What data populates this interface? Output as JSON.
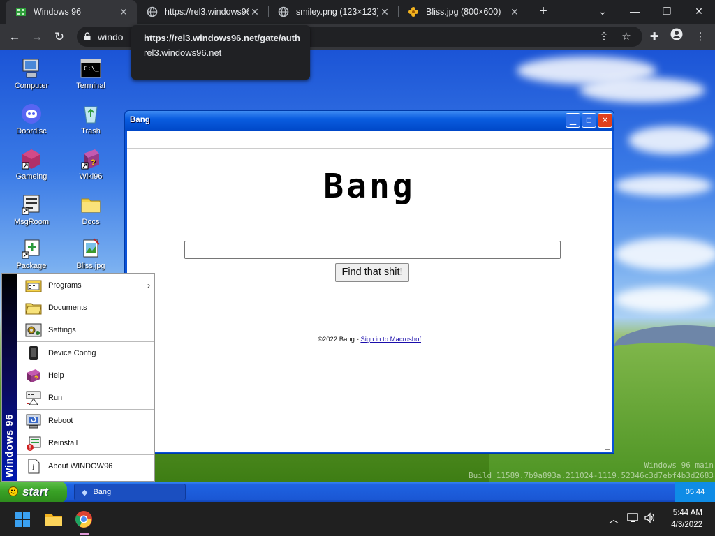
{
  "browser": {
    "tabs": [
      {
        "title": "Windows 96",
        "favicon": "windows96-favicon",
        "active": true
      },
      {
        "title": "https://rel3.windows96",
        "favicon": "globe-icon",
        "active": false
      },
      {
        "title": "smiley.png (123×123)",
        "favicon": "globe-icon",
        "active": false
      },
      {
        "title": "Bliss.jpg (800×600)",
        "favicon": "flower-icon",
        "active": false
      }
    ],
    "close_glyph": "✕",
    "new_tab_glyph": "+",
    "omnibox_text": "windo",
    "tooltip": {
      "url": "https://rel3.windows96.net/gate/auth",
      "host": "rel3.windows96.net"
    }
  },
  "desktop": {
    "icons": [
      {
        "label": "Computer",
        "icon": "computer-icon"
      },
      {
        "label": "Terminal",
        "icon": "terminal-icon"
      },
      {
        "label": "Doordisc",
        "icon": "discord-icon"
      },
      {
        "label": "Trash",
        "icon": "recycle-bin-icon"
      },
      {
        "label": "Gameing",
        "icon": "game-cube-icon"
      },
      {
        "label": "Wiki96",
        "icon": "book-icon"
      },
      {
        "label": "MsgRoom",
        "icon": "msgroom-icon"
      },
      {
        "label": "Docs",
        "icon": "folder-icon"
      },
      {
        "label": "Package",
        "icon": "package-icon"
      },
      {
        "label": "Bliss.jpg",
        "icon": "image-file-icon"
      }
    ],
    "watermark": {
      "line1": "Windows 96 main",
      "line2": "Build 11589.7b9a893a.211024-1119.52346c3d7ebf4b3d2683"
    }
  },
  "bang_window": {
    "title": "Bang",
    "logo": "Bang",
    "search_value": "",
    "button_label": "Find that shit!",
    "footer_text": "©2022 Bang - ",
    "footer_link": "Sign in to Macroshof"
  },
  "start_menu": {
    "side_label": "Windows 96",
    "items": [
      {
        "label": "Programs",
        "icon": "programs-icon",
        "submenu": true
      },
      {
        "label": "Documents",
        "icon": "documents-folder-icon"
      },
      {
        "label": "Settings",
        "icon": "settings-icon"
      },
      {
        "label": "Device Config",
        "icon": "device-icon"
      },
      {
        "label": "Help",
        "icon": "help-book-icon"
      },
      {
        "label": "Run",
        "icon": "run-icon"
      },
      {
        "label": "Reboot",
        "icon": "reboot-icon"
      },
      {
        "label": "Reinstall",
        "icon": "reinstall-icon"
      },
      {
        "label": "About WINDOW96",
        "icon": "about-icon"
      }
    ]
  },
  "w96_taskbar": {
    "start_label": "start",
    "task_label": "Bang",
    "clock": "05:44"
  },
  "win11_taskbar": {
    "time": "5:44 AM",
    "date": "4/3/2022"
  },
  "colors": {
    "xp_blue": "#0a52d8",
    "start_green": "#39a226",
    "chrome_dark": "#202124"
  }
}
